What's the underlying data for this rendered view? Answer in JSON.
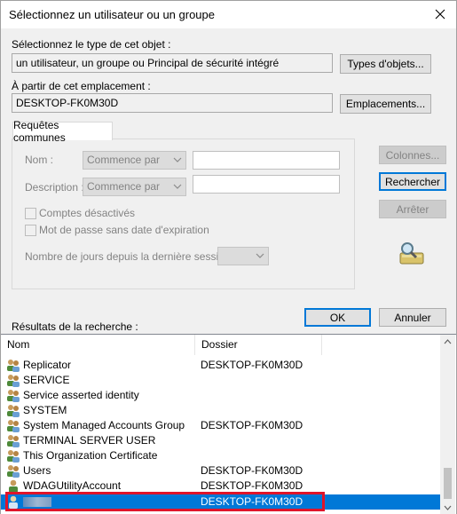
{
  "window": {
    "title": "Sélectionnez un utilisateur ou un groupe"
  },
  "object_type": {
    "label": "Sélectionnez le type de cet objet :",
    "value": "un utilisateur, un groupe ou Principal de sécurité intégré",
    "button": "Types d'objets..."
  },
  "location": {
    "label": "À partir de cet emplacement :",
    "value": "DESKTOP-FK0M30D",
    "button": "Emplacements..."
  },
  "tab": {
    "label": "Requêtes communes"
  },
  "query": {
    "name_label": "Nom :",
    "name_combo": "Commence par",
    "description_label": "Description :",
    "description_combo": "Commence par",
    "disabled_accounts": "Comptes désactivés",
    "no_expiry": "Mot de passe sans date d'expiration",
    "days_label": "Nombre de jours depuis la dernière session :"
  },
  "side_buttons": {
    "columns": "Colonnes...",
    "search": "Rechercher",
    "stop": "Arrêter"
  },
  "dialog_buttons": {
    "ok": "OK",
    "cancel": "Annuler"
  },
  "results": {
    "label": "Résultats de la recherche :",
    "columns": [
      "Nom",
      "Dossier"
    ],
    "rows": [
      {
        "name": "Replicator",
        "folder": "DESKTOP-FK0M30D",
        "icon": "group-icon"
      },
      {
        "name": "SERVICE",
        "folder": "",
        "icon": "group-icon"
      },
      {
        "name": "Service asserted identity",
        "folder": "",
        "icon": "group-icon"
      },
      {
        "name": "SYSTEM",
        "folder": "",
        "icon": "group-icon"
      },
      {
        "name": "System Managed Accounts Group",
        "folder": "DESKTOP-FK0M30D",
        "icon": "group-icon"
      },
      {
        "name": "TERMINAL SERVER USER",
        "folder": "",
        "icon": "group-icon"
      },
      {
        "name": "This Organization Certificate",
        "folder": "",
        "icon": "group-icon"
      },
      {
        "name": "Users",
        "folder": "DESKTOP-FK0M30D",
        "icon": "group-icon"
      },
      {
        "name": "WDAGUtilityAccount",
        "folder": "DESKTOP-FK0M30D",
        "icon": "user-icon"
      },
      {
        "name": "",
        "folder": "DESKTOP-FK0M30D",
        "icon": "user-icon",
        "selected": true
      }
    ]
  },
  "colors": {
    "selection": "#0078d7",
    "highlight_outline": "#e0142a",
    "default_button": "#0078d7"
  }
}
